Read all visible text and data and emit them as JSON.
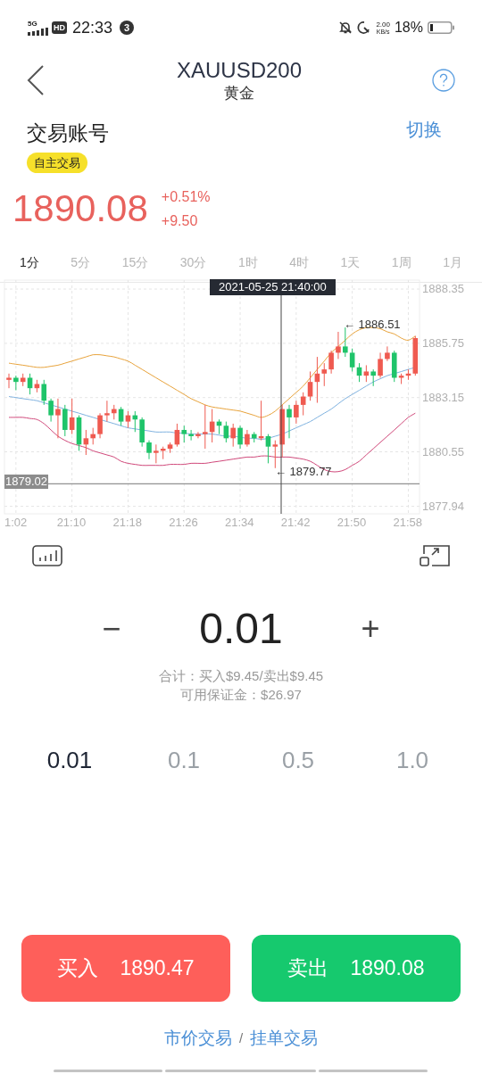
{
  "status_bar": {
    "network": "5G",
    "hd": "HD",
    "time": "22:33",
    "notification_count": "3",
    "speed": "2.00",
    "speed_unit": "KB/s",
    "battery": "18%"
  },
  "header": {
    "title": "XAUUSD200",
    "subtitle": "黄金"
  },
  "account": {
    "title": "交易账号",
    "badge": "自主交易",
    "switch_link": "切换"
  },
  "quote": {
    "price": "1890.08",
    "change_percent": "+0.51%",
    "change": "+9.50"
  },
  "timeframes": [
    {
      "label": "1分",
      "selected": true
    },
    {
      "label": "5分",
      "selected": false
    },
    {
      "label": "15分",
      "selected": false
    },
    {
      "label": "30分",
      "selected": false
    },
    {
      "label": "1时",
      "selected": false
    },
    {
      "label": "4时",
      "selected": false
    },
    {
      "label": "1天",
      "selected": false
    },
    {
      "label": "1周",
      "selected": false
    },
    {
      "label": "1月",
      "selected": false
    }
  ],
  "chart": {
    "crosshair_time": "2021-05-25 21:40:00",
    "high_marker": "← 1886.51",
    "low_marker": "← 1879.77",
    "chart_data": {
      "type": "candlestick",
      "grid": true,
      "ref_lines": [
        {
          "axis": "y",
          "value": 1879.02,
          "label": "1879.02"
        }
      ],
      "categories": [
        null,
        "1:02",
        null,
        null,
        null,
        null,
        null,
        null,
        null,
        "21:10",
        null,
        null,
        null,
        null,
        null,
        null,
        null,
        "21:18",
        null,
        null,
        null,
        null,
        null,
        null,
        null,
        "21:26",
        null,
        null,
        null,
        null,
        null,
        null,
        null,
        "21:34",
        null,
        null,
        null,
        null,
        null,
        null,
        null,
        "21:42",
        null,
        null,
        null,
        null,
        null,
        null,
        null,
        "21:50",
        null,
        null,
        null,
        null,
        null,
        null,
        null,
        "21:58",
        null
      ],
      "yticks": [
        1888.35,
        1885.75,
        1883.15,
        1880.55,
        1877.94
      ],
      "ylim": [
        1877.58,
        1888.78
      ],
      "ohlc": [
        [
          1884.0,
          1884.3,
          1883.6,
          1884.1
        ],
        [
          1884.1,
          1884.2,
          1883.5,
          1883.9
        ],
        [
          1883.9,
          1884.3,
          1883.7,
          1884.1
        ],
        [
          1884.1,
          1884.3,
          1883.3,
          1883.6
        ],
        [
          1883.6,
          1884.0,
          1883.4,
          1883.8
        ],
        [
          1883.8,
          1884.0,
          1882.8,
          1883.0
        ],
        [
          1883.0,
          1883.1,
          1882.0,
          1882.3
        ],
        [
          1882.3,
          1883.1,
          1881.2,
          1882.6
        ],
        [
          1882.6,
          1882.8,
          1881.3,
          1881.6
        ],
        [
          1881.6,
          1883.1,
          1881.4,
          1882.2
        ],
        [
          1882.2,
          1882.3,
          1880.6,
          1880.9
        ],
        [
          1880.9,
          1881.6,
          1880.4,
          1881.2
        ],
        [
          1881.2,
          1881.7,
          1880.9,
          1881.4
        ],
        [
          1881.4,
          1882.4,
          1881.2,
          1882.3
        ],
        [
          1882.3,
          1883.0,
          1882.0,
          1882.4
        ],
        [
          1882.4,
          1882.8,
          1882.1,
          1882.6
        ],
        [
          1882.6,
          1882.7,
          1881.8,
          1882.0
        ],
        [
          1882.0,
          1882.5,
          1881.7,
          1882.3
        ],
        [
          1882.3,
          1882.5,
          1881.5,
          1882.1
        ],
        [
          1882.1,
          1882.2,
          1880.8,
          1881.0
        ],
        [
          1881.0,
          1881.1,
          1880.2,
          1880.5
        ],
        [
          1880.5,
          1880.9,
          1880.0,
          1880.6
        ],
        [
          1880.6,
          1880.8,
          1880.2,
          1880.7
        ],
        [
          1880.7,
          1881.0,
          1880.5,
          1880.9
        ],
        [
          1880.9,
          1881.9,
          1880.8,
          1881.6
        ],
        [
          1881.6,
          1881.8,
          1881.0,
          1881.4
        ],
        [
          1881.4,
          1881.6,
          1881.1,
          1881.3
        ],
        [
          1881.3,
          1881.5,
          1881.2,
          1881.4
        ],
        [
          1881.4,
          1882.8,
          1880.7,
          1881.5
        ],
        [
          1881.5,
          1882.6,
          1881.0,
          1882.0
        ],
        [
          1882.0,
          1882.1,
          1881.4,
          1881.8
        ],
        [
          1881.8,
          1882.0,
          1881.0,
          1881.2
        ],
        [
          1881.2,
          1881.9,
          1880.8,
          1881.7
        ],
        [
          1881.7,
          1881.8,
          1880.7,
          1880.9
        ],
        [
          1880.9,
          1881.6,
          1880.8,
          1881.4
        ],
        [
          1881.4,
          1881.5,
          1881.0,
          1881.2
        ],
        [
          1881.2,
          1883.0,
          1881.1,
          1881.3
        ],
        [
          1881.3,
          1881.4,
          1880.0,
          1880.8
        ],
        [
          1880.8,
          1881.1,
          1879.77,
          1880.9
        ],
        [
          1880.9,
          1882.8,
          1880.3,
          1882.6
        ],
        [
          1882.6,
          1882.8,
          1881.2,
          1882.2
        ],
        [
          1882.2,
          1883.0,
          1881.9,
          1882.8
        ],
        [
          1882.8,
          1883.4,
          1882.3,
          1883.2
        ],
        [
          1883.2,
          1884.4,
          1883.0,
          1883.9
        ],
        [
          1883.9,
          1885.1,
          1882.9,
          1884.3
        ],
        [
          1884.3,
          1884.8,
          1883.7,
          1884.5
        ],
        [
          1884.5,
          1885.4,
          1884.3,
          1885.3
        ],
        [
          1885.3,
          1886.3,
          1885.0,
          1885.6
        ],
        [
          1885.6,
          1886.51,
          1885.1,
          1885.3
        ],
        [
          1885.3,
          1885.5,
          1884.4,
          1884.6
        ],
        [
          1884.6,
          1884.8,
          1883.9,
          1884.2
        ],
        [
          1884.2,
          1884.7,
          1883.9,
          1884.4
        ],
        [
          1884.4,
          1884.5,
          1883.7,
          1884.2
        ],
        [
          1884.2,
          1885.3,
          1884.1,
          1885.0
        ],
        [
          1885.0,
          1885.6,
          1884.9,
          1885.3
        ],
        [
          1885.3,
          1885.4,
          1883.9,
          1884.1
        ],
        [
          1884.1,
          1884.3,
          1883.8,
          1884.2
        ],
        [
          1884.2,
          1884.5,
          1884.0,
          1884.3
        ],
        [
          1884.3,
          1886.1,
          1884.2,
          1886.0
        ]
      ],
      "series": [
        {
          "type": "line",
          "color": "#e8a33b",
          "values": [
            1884.8,
            1884.75,
            1884.7,
            1884.65,
            1884.6,
            1884.6,
            1884.65,
            1884.7,
            1884.8,
            1884.9,
            1885.0,
            1885.1,
            1885.2,
            1885.2,
            1885.15,
            1885.1,
            1885.0,
            1884.9,
            1884.7,
            1884.5,
            1884.3,
            1884.1,
            1883.9,
            1883.7,
            1883.5,
            1883.3,
            1883.1,
            1882.95,
            1882.8,
            1882.7,
            1882.65,
            1882.6,
            1882.55,
            1882.5,
            1882.4,
            1882.3,
            1882.2,
            1882.3,
            1882.5,
            1882.8,
            1883.1,
            1883.4,
            1883.7,
            1884.1,
            1884.5,
            1884.9,
            1885.3,
            1885.6,
            1885.9,
            1886.2,
            1886.4,
            1886.5,
            1886.5,
            1886.45,
            1886.3,
            1886.2,
            1886.0,
            1885.9,
            1886.1
          ]
        },
        {
          "type": "line",
          "color": "#7fb2e0",
          "values": [
            1883.2,
            1883.15,
            1883.1,
            1883.05,
            1883.0,
            1882.9,
            1882.8,
            1882.7,
            1882.6,
            1882.5,
            1882.4,
            1882.3,
            1882.2,
            1882.1,
            1882.0,
            1881.9,
            1881.8,
            1881.7,
            1881.65,
            1881.6,
            1881.55,
            1881.5,
            1881.5,
            1881.5,
            1881.45,
            1881.45,
            1881.4,
            1881.4,
            1881.4,
            1881.4,
            1881.35,
            1881.3,
            1881.3,
            1881.25,
            1881.2,
            1881.2,
            1881.15,
            1881.2,
            1881.3,
            1881.4,
            1881.55,
            1881.7,
            1881.85,
            1882.0,
            1882.2,
            1882.4,
            1882.6,
            1882.85,
            1883.1,
            1883.3,
            1883.5,
            1883.7,
            1883.9,
            1884.05,
            1884.2,
            1884.3,
            1884.4,
            1884.5,
            1884.6
          ]
        },
        {
          "type": "line",
          "color": "#d0487a",
          "values": [
            1882.2,
            1882.2,
            1882.2,
            1882.15,
            1882.1,
            1881.9,
            1881.6,
            1881.3,
            1881.1,
            1880.95,
            1880.85,
            1880.75,
            1880.6,
            1880.5,
            1880.4,
            1880.3,
            1880.1,
            1880.0,
            1879.95,
            1879.9,
            1879.9,
            1879.9,
            1879.9,
            1879.95,
            1879.95,
            1879.95,
            1880.0,
            1880.0,
            1880.0,
            1880.05,
            1880.1,
            1880.15,
            1880.2,
            1880.25,
            1880.3,
            1880.3,
            1880.35,
            1880.35,
            1880.3,
            1880.3,
            1880.3,
            1880.25,
            1880.2,
            1880.1,
            1879.9,
            1879.7,
            1879.6,
            1879.6,
            1879.7,
            1879.9,
            1880.1,
            1880.4,
            1880.7,
            1881.0,
            1881.3,
            1881.6,
            1881.9,
            1882.2,
            1882.4
          ]
        }
      ]
    }
  },
  "lot": {
    "minus": "−",
    "value": "0.01",
    "plus": "+",
    "total": "合计：买入$9.45/卖出$9.45",
    "margin": "可用保证金：$26.97"
  },
  "quick_lots": [
    {
      "label": "0.01",
      "selected": true
    },
    {
      "label": "0.1",
      "selected": false
    },
    {
      "label": "0.5",
      "selected": false
    },
    {
      "label": "1.0",
      "selected": false
    }
  ],
  "actions": [
    {
      "kind": "buy",
      "label": "买入",
      "price": "1890.47"
    },
    {
      "kind": "sell",
      "label": "卖出",
      "price": "1890.08"
    }
  ],
  "order_modes": {
    "market": "市价交易",
    "separator": "/",
    "pending": "挂单交易"
  }
}
